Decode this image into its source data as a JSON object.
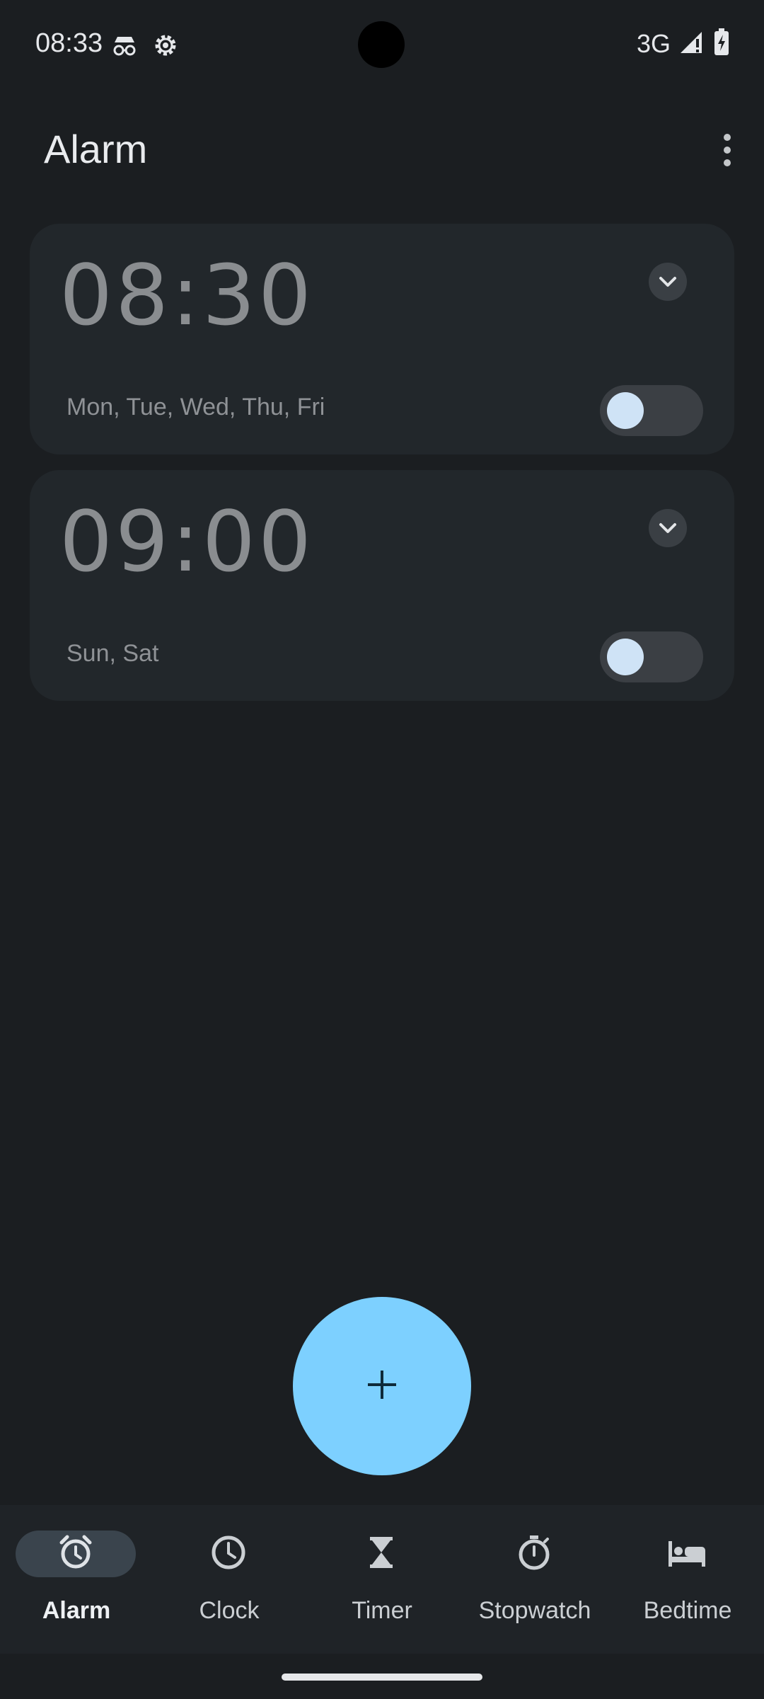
{
  "status_bar": {
    "time": "08:33",
    "icons": [
      "incognito-icon",
      "settings-gear-icon"
    ],
    "network": "3G",
    "signal_icon": "cell-signal-icon",
    "battery_icon": "battery-charging-icon"
  },
  "app_bar": {
    "title": "Alarm",
    "overflow_icon": "more-vert-icon"
  },
  "alarms": [
    {
      "time": "08:30",
      "days": "Mon, Tue, Wed, Thu, Fri",
      "enabled": false
    },
    {
      "time": "09:00",
      "days": "Sun, Sat",
      "enabled": false
    }
  ],
  "fab": {
    "icon": "plus-icon"
  },
  "bottom_nav": {
    "items": [
      {
        "label": "Alarm",
        "icon": "alarm-icon",
        "active": true
      },
      {
        "label": "Clock",
        "icon": "clock-icon",
        "active": false
      },
      {
        "label": "Timer",
        "icon": "hourglass-icon",
        "active": false
      },
      {
        "label": "Stopwatch",
        "icon": "stopwatch-icon",
        "active": false
      },
      {
        "label": "Bedtime",
        "icon": "bed-icon",
        "active": false
      }
    ]
  },
  "colors": {
    "background": "#1b1e21",
    "card": "#22272b",
    "fab": "#7dd0ff",
    "toggle_track": "#3b3f44",
    "toggle_knob": "#cfe3f6"
  }
}
